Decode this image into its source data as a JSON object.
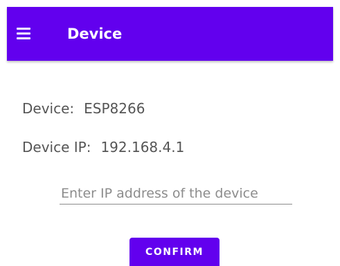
{
  "app_bar": {
    "title": "Device",
    "menu_icon": "hamburger-menu-icon",
    "background": "#6200ee"
  },
  "device": {
    "label": "Device:",
    "value": "ESP8266"
  },
  "device_ip": {
    "label": "Device IP:",
    "value": "192.168.4.1"
  },
  "ip_input": {
    "value": "",
    "placeholder": "Enter IP address of the device"
  },
  "confirm_button": {
    "label": "CONFIRM",
    "background": "#6200ee"
  }
}
